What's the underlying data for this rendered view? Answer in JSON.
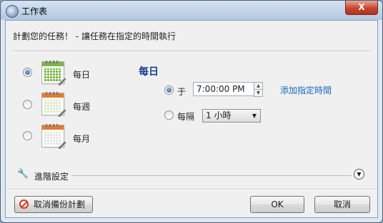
{
  "window": {
    "title": "工作表",
    "close_label": "X"
  },
  "header": {
    "subtitle": "計劃您的任務！ - 讓任務在指定的時間執行"
  },
  "frequency": {
    "options": [
      {
        "label": "每日",
        "selected": true
      },
      {
        "label": "每週",
        "selected": false
      },
      {
        "label": "每月",
        "selected": false
      }
    ]
  },
  "detail": {
    "title": "每日",
    "at_label": "于",
    "time_value": "7:00:00 PM",
    "add_time_link": "添加指定時間",
    "every_label": "每隔",
    "interval_value": "1 小時"
  },
  "advanced": {
    "label": "進階設定"
  },
  "footer": {
    "cancel_backup_label": "取消備份計劃",
    "ok_label": "OK",
    "cancel_label": "取消"
  },
  "colors": {
    "accent": "#1a3f8c",
    "link": "#1566c0",
    "close": "#c7452f"
  }
}
